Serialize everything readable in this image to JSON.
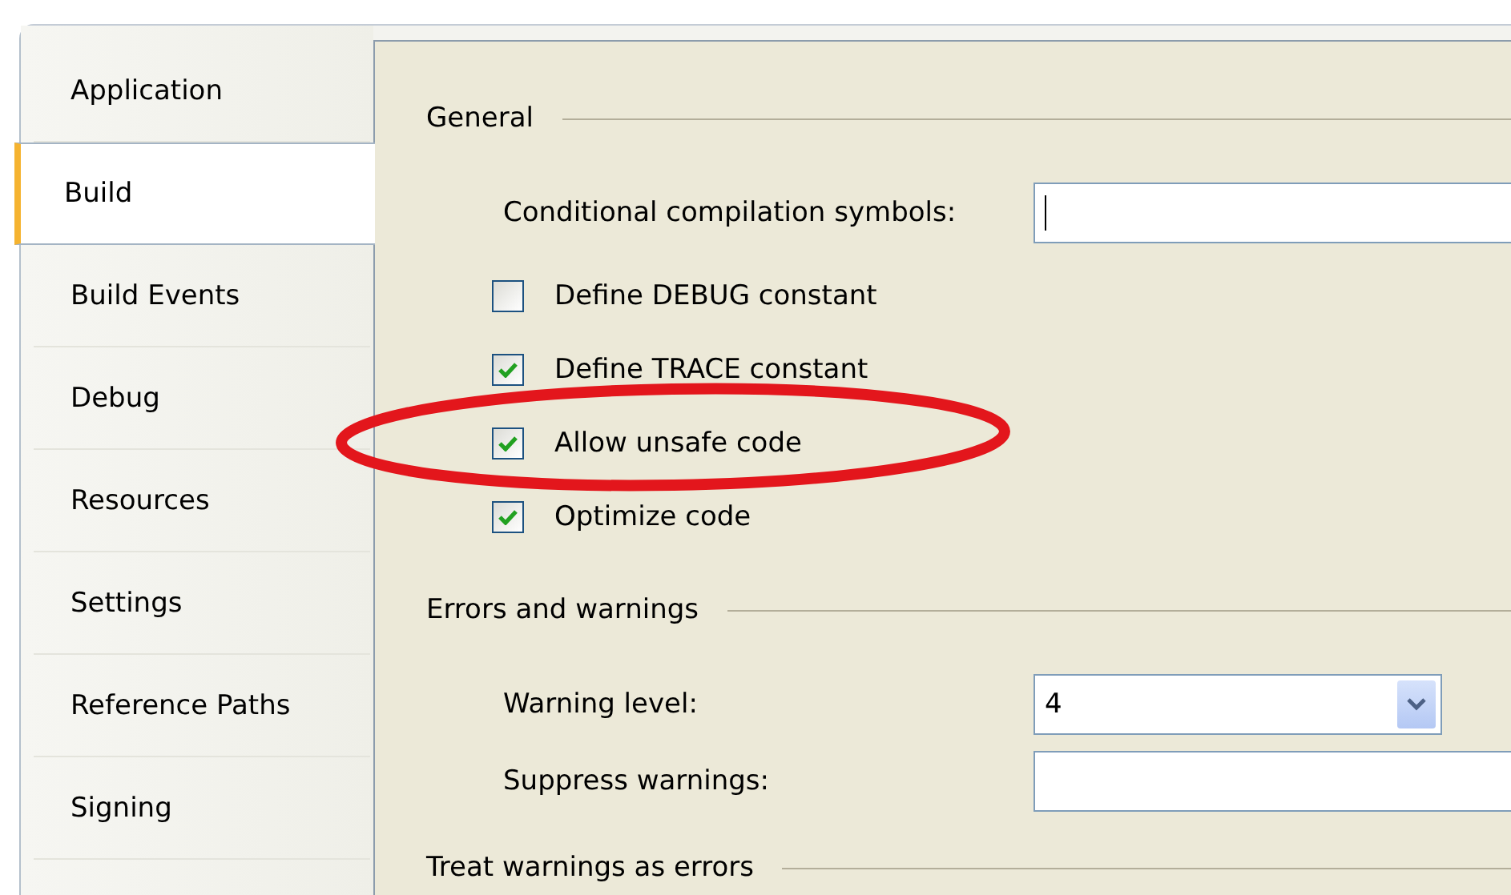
{
  "sidebar": {
    "items": [
      {
        "label": "Application",
        "selected": false
      },
      {
        "label": "Build",
        "selected": true
      },
      {
        "label": "Build Events",
        "selected": false
      },
      {
        "label": "Debug",
        "selected": false
      },
      {
        "label": "Resources",
        "selected": false
      },
      {
        "label": "Settings",
        "selected": false
      },
      {
        "label": "Reference Paths",
        "selected": false
      },
      {
        "label": "Signing",
        "selected": false
      }
    ]
  },
  "sections": [
    {
      "title": "General",
      "rows": [
        {
          "kind": "text",
          "label": "Conditional compilation symbols:",
          "focused": true
        },
        {
          "kind": "checkbox",
          "label": "Define DEBUG constant",
          "checked": false
        },
        {
          "kind": "checkbox",
          "label": "Define TRACE constant",
          "checked": true
        },
        {
          "kind": "checkbox",
          "label": "Allow unsafe code",
          "checked": true
        },
        {
          "kind": "checkbox",
          "label": "Optimize code",
          "checked": true
        }
      ]
    },
    {
      "title": "Errors and warnings",
      "rows": [
        {
          "kind": "dropdown",
          "label": "Warning level:",
          "value": "4"
        },
        {
          "kind": "text",
          "label": "Suppress warnings:"
        }
      ]
    },
    {
      "title": "Treat warnings as errors"
    }
  ]
}
